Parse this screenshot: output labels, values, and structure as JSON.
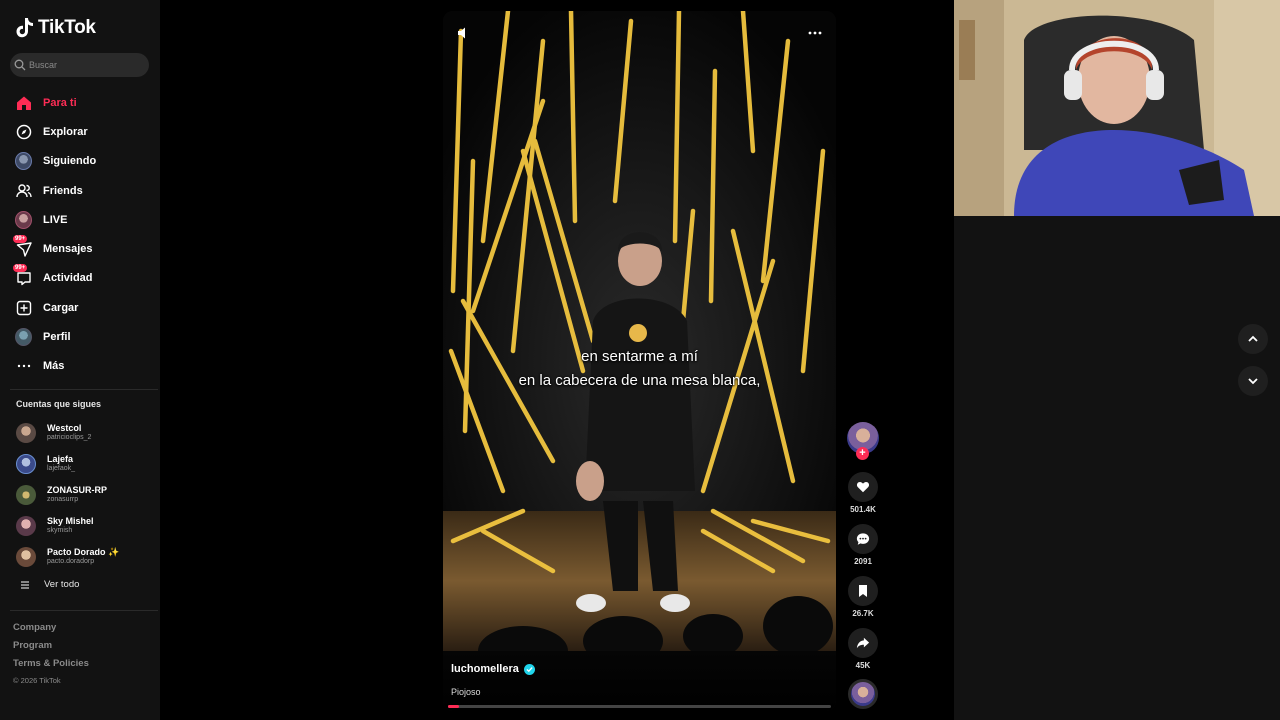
{
  "app": {
    "name": "TikTok"
  },
  "search": {
    "placeholder": "Buscar"
  },
  "nav": {
    "items": [
      {
        "label": "Para ti",
        "icon": "home-icon",
        "active": true
      },
      {
        "label": "Explorar",
        "icon": "compass-icon"
      },
      {
        "label": "Siguiendo",
        "icon": "following-avatar-icon"
      },
      {
        "label": "Friends",
        "icon": "friends-icon"
      },
      {
        "label": "LIVE",
        "icon": "live-icon"
      },
      {
        "label": "Mensajes",
        "icon": "messages-icon",
        "badge": "99+"
      },
      {
        "label": "Actividad",
        "icon": "activity-icon",
        "badge": "99+"
      },
      {
        "label": "Cargar",
        "icon": "upload-icon"
      },
      {
        "label": "Perfil",
        "icon": "profile-icon"
      },
      {
        "label": "Más",
        "icon": "more-dots-icon"
      }
    ]
  },
  "following": {
    "title": "Cuentas que sigues",
    "accounts": [
      {
        "name": "Westcol",
        "handle": "patricioclips_2"
      },
      {
        "name": "Lajefa",
        "handle": "lajefaok_"
      },
      {
        "name": "ZONASUR-RP",
        "handle": "zonasurrp"
      },
      {
        "name": "Sky Mishel",
        "handle": "skymish"
      },
      {
        "name": "Pacto Dorado ✨",
        "handle": "pacto.doradorp"
      }
    ],
    "see_all": "Ver todo"
  },
  "footer": {
    "links": [
      "Company",
      "Program",
      "Terms & Policies"
    ],
    "copyright": "© 2026 TikTok"
  },
  "video": {
    "subtitle_line1": "en sentarme a mí",
    "subtitle_line2": "en la cabecera de una mesa blanca,",
    "creator": "luchomellera",
    "caption": "Piojoso",
    "progress": 0.03
  },
  "actions": {
    "likes": "501.4K",
    "comments": "2091",
    "saves": "26.7K",
    "shares": "45K"
  },
  "colors": {
    "accent": "#fe2c55",
    "background": "#121212",
    "stage_light": "#f2c640"
  }
}
